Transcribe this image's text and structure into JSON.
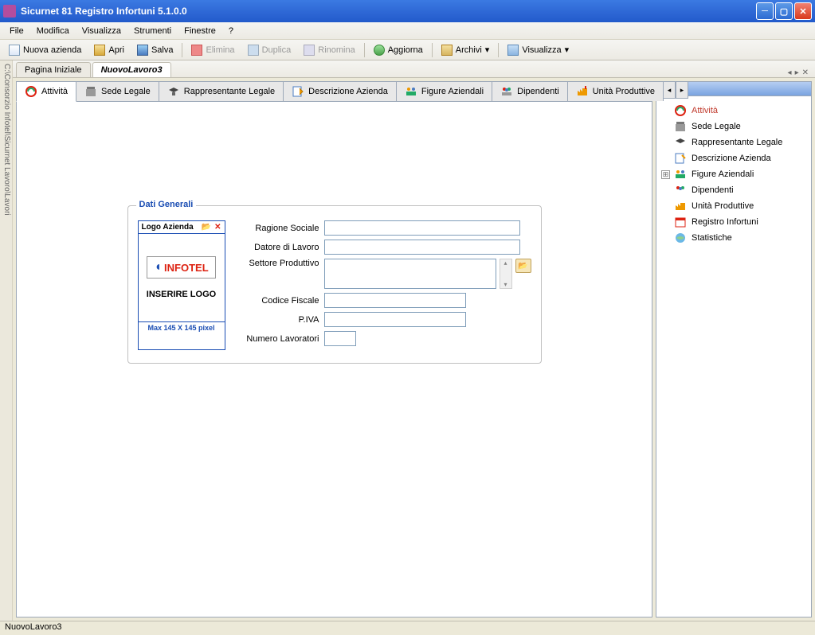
{
  "window": {
    "title": "Sicurnet 81 Registro Infortuni 5.1.0.0"
  },
  "menu": {
    "file": "File",
    "modifica": "Modifica",
    "visualizza": "Visualizza",
    "strumenti": "Strumenti",
    "finestre": "Finestre",
    "help": "?"
  },
  "toolbar": {
    "nuova_azienda": "Nuova azienda",
    "apri": "Apri",
    "salva": "Salva",
    "elimina": "Elimina",
    "duplica": "Duplica",
    "rinomina": "Rinomina",
    "aggiorna": "Aggiorna",
    "archivi": "Archivi",
    "visualizza": "Visualizza"
  },
  "left_sidebar_text": "C:\\Consorzio Infotel\\Sicurnet Lavoro\\Lavori",
  "doc_tabs": {
    "pagina_iniziale": "Pagina Iniziale",
    "nuovo_lavoro": "NuovoLavoro3"
  },
  "inner_tabs": {
    "attivita": "Attività",
    "sede_legale": "Sede Legale",
    "rappresentante": "Rappresentante Legale",
    "descrizione": "Descrizione Azienda",
    "figure": "Figure Aziendali",
    "dipendenti": "Dipendenti",
    "unita": "Unità Produttive"
  },
  "form": {
    "legend": "Dati Generali",
    "logo_head": "Logo Azienda",
    "logo_brand": "INFOTEL",
    "logo_insert": "INSERIRE LOGO",
    "logo_foot": "Max 145 X 145 pixel",
    "labels": {
      "ragione_sociale": "Ragione Sociale",
      "datore": "Datore di Lavoro",
      "settore": "Settore Produttivo",
      "codice_fiscale": "Codice Fiscale",
      "piva": "P.IVA",
      "num_lavoratori": "Numero Lavoratori"
    },
    "values": {
      "ragione_sociale": "",
      "datore": "",
      "settore": "",
      "codice_fiscale": "",
      "piva": "",
      "num_lavoratori": ""
    }
  },
  "tree": {
    "attivita": "Attività",
    "sede_legale": "Sede Legale",
    "rappresentante": "Rappresentante Legale",
    "descrizione": "Descrizione Azienda",
    "figure": "Figure Aziendali",
    "dipendenti": "Dipendenti",
    "unita": "Unità Produttive",
    "registro": "Registro Infortuni",
    "statistiche": "Statistiche"
  },
  "statusbar": "NuovoLavoro3"
}
